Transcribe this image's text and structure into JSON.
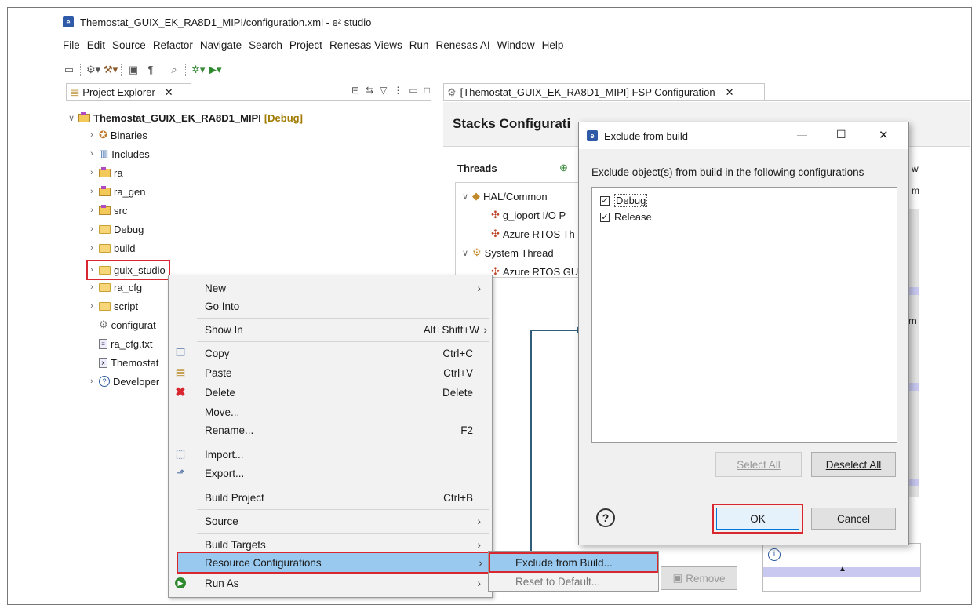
{
  "window": {
    "title": "Themostat_GUIX_EK_RA8D1_MIPI/configuration.xml - e² studio"
  },
  "menubar": [
    "File",
    "Edit",
    "Source",
    "Refactor",
    "Navigate",
    "Search",
    "Project",
    "Renesas Views",
    "Run",
    "Renesas AI",
    "Window",
    "Help"
  ],
  "project_explorer": {
    "tab_label": "Project Explorer",
    "root": {
      "name": "Themostat_GUIX_EK_RA8D1_MIPI",
      "tag": "[Debug]"
    },
    "items": [
      {
        "label": "Binaries",
        "icon": "binaries-icon"
      },
      {
        "label": "Includes",
        "icon": "includes-icon"
      },
      {
        "label": "ra",
        "icon": "package-folder-icon"
      },
      {
        "label": "ra_gen",
        "icon": "package-folder-icon"
      },
      {
        "label": "src",
        "icon": "package-folder-icon"
      },
      {
        "label": "Debug",
        "icon": "folder-icon"
      },
      {
        "label": "build",
        "icon": "folder-icon"
      },
      {
        "label": "guix_studio",
        "icon": "folder-icon"
      },
      {
        "label": "ra_cfg",
        "icon": "folder-icon"
      },
      {
        "label": "script",
        "icon": "folder-icon"
      },
      {
        "label": "configurat",
        "icon": "gear-file-icon"
      },
      {
        "label": "ra_cfg.txt",
        "icon": "text-file-icon"
      },
      {
        "label": "Themostat",
        "icon": "xml-file-icon"
      },
      {
        "label": "Developer",
        "icon": "help-icon"
      }
    ]
  },
  "fsp": {
    "tab_label": "[Themostat_GUIX_EK_RA8D1_MIPI] FSP Configuration",
    "heading": "Stacks Configurati",
    "threads_label": "Threads",
    "threads": [
      {
        "label": "HAL/Common"
      },
      {
        "label": "g_ioport I/O P"
      },
      {
        "label": "Azure RTOS Th"
      },
      {
        "label": "System Thread"
      },
      {
        "label": "Azure RTOS GU"
      }
    ],
    "remove_label": "Remove",
    "right_clip": [
      "w",
      "m",
      "rn"
    ]
  },
  "context_menu": {
    "items": [
      {
        "label": "New",
        "shortcut": "",
        "submenu": true
      },
      {
        "label": "Go Into",
        "shortcut": ""
      },
      {
        "label": "Show In",
        "shortcut": "Alt+Shift+W"
      },
      {
        "label": "Copy",
        "shortcut": "Ctrl+C"
      },
      {
        "label": "Paste",
        "shortcut": "Ctrl+V"
      },
      {
        "label": "Delete",
        "shortcut": "Delete"
      },
      {
        "label": "Move...",
        "shortcut": ""
      },
      {
        "label": "Rename...",
        "shortcut": "F2"
      },
      {
        "label": "Import...",
        "shortcut": ""
      },
      {
        "label": "Export...",
        "shortcut": ""
      },
      {
        "label": "Build Project",
        "shortcut": "Ctrl+B"
      },
      {
        "label": "Source",
        "shortcut": ""
      },
      {
        "label": "Build Targets",
        "shortcut": ""
      },
      {
        "label": "Resource Configurations",
        "shortcut": ""
      },
      {
        "label": "Run As",
        "shortcut": ""
      }
    ]
  },
  "submenu": {
    "items": [
      "Exclude from Build...",
      "Reset to Default..."
    ]
  },
  "dialog": {
    "title": "Exclude from build",
    "instruction": "Exclude object(s) from build in the following configurations",
    "configs": [
      {
        "label": "Debug",
        "checked": true
      },
      {
        "label": "Release",
        "checked": true
      }
    ],
    "select_all": "Select All",
    "deselect_all": "Deselect All",
    "ok": "OK",
    "cancel": "Cancel"
  },
  "colors": {
    "highlight": "#99c9ef",
    "callout_red": "#d8272f",
    "arrow": "#2f5d7a",
    "selection_lilac": "#c8c8f0"
  }
}
